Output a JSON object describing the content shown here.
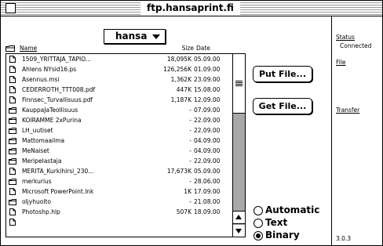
{
  "window": {
    "title": "ftp.hansaprint.fi"
  },
  "folder_popup": {
    "label": "hansa"
  },
  "columns": {
    "name": "Name",
    "size": "Size",
    "date": "Date"
  },
  "files": [
    {
      "type": "file",
      "name": "1509_YRITTAJA_TAPIO...",
      "size": "18,095K",
      "date": "05.09.00"
    },
    {
      "type": "file",
      "name": "Ahlens NYsid16.ps",
      "size": "126,256K",
      "date": "01.09.00"
    },
    {
      "type": "file",
      "name": "Asennus.msi",
      "size": "1,362K",
      "date": "23.09.00"
    },
    {
      "type": "file",
      "name": "CEDERROTH_TTT008.pdf",
      "size": "447K",
      "date": "15.08.00"
    },
    {
      "type": "file",
      "name": "Finnsec_Turvallisuus.pdf",
      "size": "1,187K",
      "date": "12.09.00"
    },
    {
      "type": "folder",
      "name": "KauppaJaTeollisuus",
      "size": "-",
      "date": "07.09.00"
    },
    {
      "type": "folder",
      "name": "KOIRAMME 2xPurina",
      "size": "-",
      "date": "22.09.00"
    },
    {
      "type": "folder",
      "name": "LH_uutiset",
      "size": "-",
      "date": "22.09.00"
    },
    {
      "type": "folder",
      "name": "Mattomaailma",
      "size": "-",
      "date": "04.09.00"
    },
    {
      "type": "folder",
      "name": "MeNaiset",
      "size": "-",
      "date": "04.09.00"
    },
    {
      "type": "folder",
      "name": "Meripelastaja",
      "size": "-",
      "date": "22.09.00"
    },
    {
      "type": "file",
      "name": "MERITA_Kurkihirsi_230...",
      "size": "17,673K",
      "date": "05.09.00"
    },
    {
      "type": "folder",
      "name": "merkurius",
      "size": "-",
      "date": "28.06.00"
    },
    {
      "type": "file",
      "name": "Microsoft PowerPoint.lnk",
      "size": "1K",
      "date": "17.09.00"
    },
    {
      "type": "folder",
      "name": "oljyhuolto",
      "size": "-",
      "date": "21.08.00"
    },
    {
      "type": "file",
      "name": "Photoshp.hlp",
      "size": "507K",
      "date": "18.09.00"
    },
    {
      "type": "file",
      "name": "",
      "size": "",
      "date": ""
    }
  ],
  "buttons": {
    "put": "Put File...",
    "get": "Get File..."
  },
  "transfer_mode": {
    "options": [
      "Automatic",
      "Text",
      "Binary"
    ],
    "selected": "Binary"
  },
  "status_panel": {
    "status_label": "Status",
    "status_value": "Connected",
    "file_label": "File",
    "transfer_label": "Transfer",
    "version": "3.0.3"
  },
  "scroll_position": 0
}
